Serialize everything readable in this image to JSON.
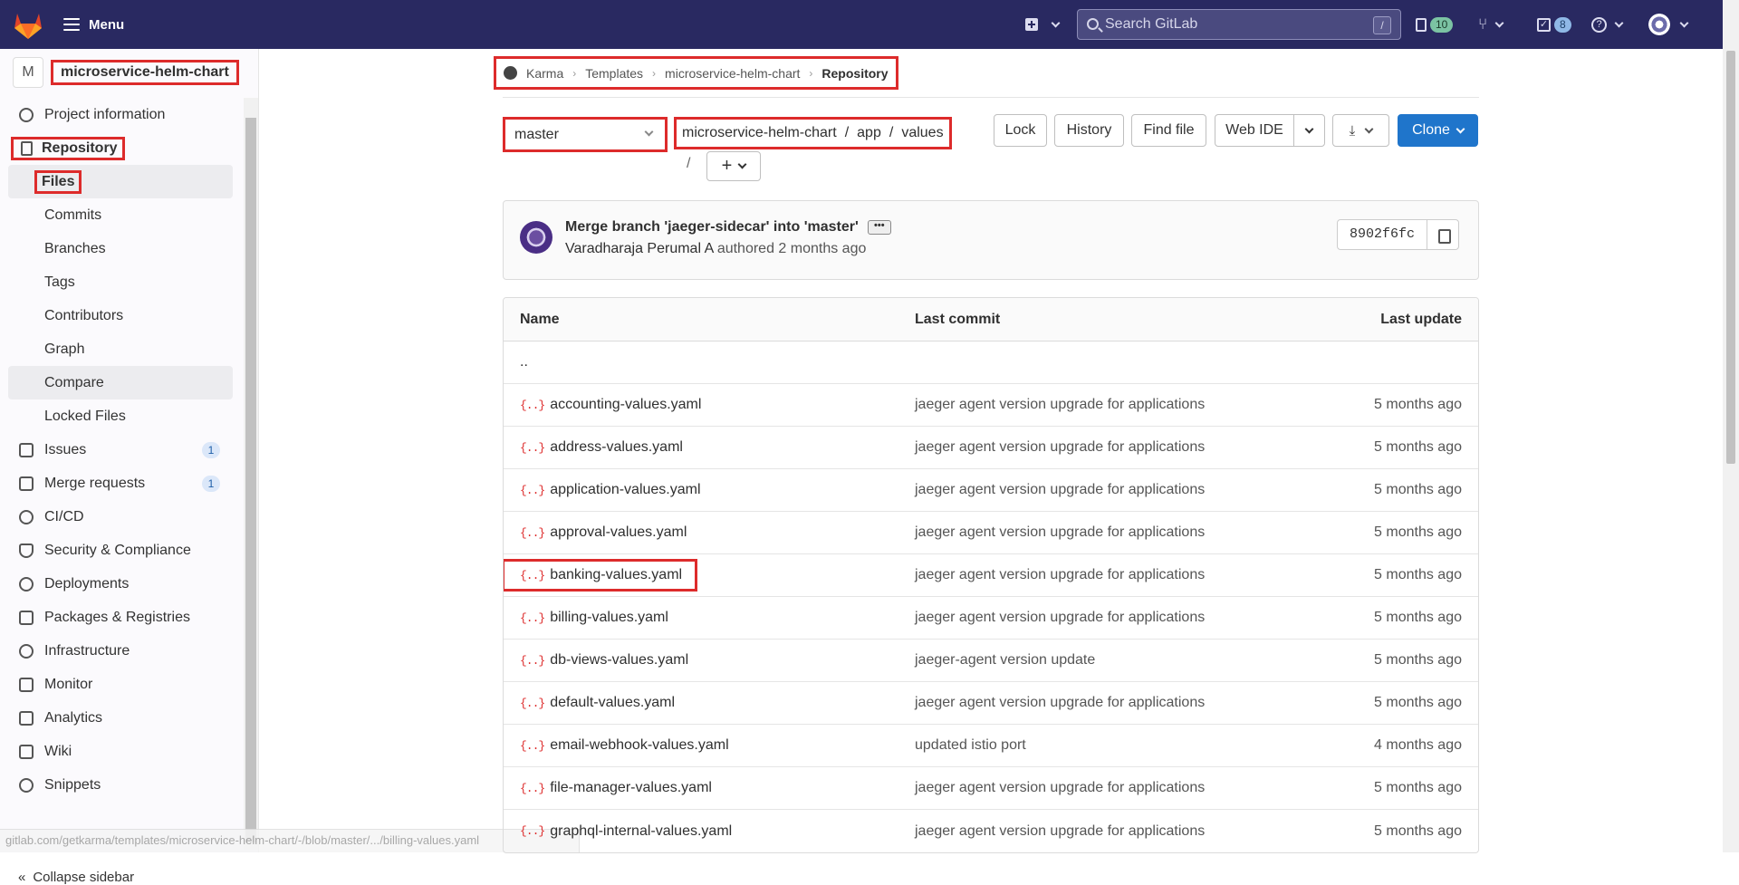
{
  "topbar": {
    "menu_label": "Menu",
    "search_placeholder": "Search GitLab",
    "search_shortcut": "/",
    "issues_count": "10",
    "todos_count": "8"
  },
  "sidebar": {
    "project_avatar": "M",
    "project_name": "microservice-helm-chart",
    "items": [
      {
        "label": "Project information"
      },
      {
        "label": "Repository"
      },
      {
        "label": "Files"
      },
      {
        "label": "Commits"
      },
      {
        "label": "Branches"
      },
      {
        "label": "Tags"
      },
      {
        "label": "Contributors"
      },
      {
        "label": "Graph"
      },
      {
        "label": "Compare"
      },
      {
        "label": "Locked Files"
      },
      {
        "label": "Issues",
        "count": "1"
      },
      {
        "label": "Merge requests",
        "count": "1"
      },
      {
        "label": "CI/CD"
      },
      {
        "label": "Security & Compliance"
      },
      {
        "label": "Deployments"
      },
      {
        "label": "Packages & Registries"
      },
      {
        "label": "Infrastructure"
      },
      {
        "label": "Monitor"
      },
      {
        "label": "Analytics"
      },
      {
        "label": "Wiki"
      },
      {
        "label": "Snippets"
      }
    ],
    "collapse_label": "Collapse sidebar"
  },
  "status_url": "gitlab.com/getkarma/templates/microservice-helm-chart/-/blob/master/.../billing-values.yaml",
  "breadcrumb": {
    "items": [
      "Karma",
      "Templates",
      "microservice-helm-chart",
      "Repository"
    ]
  },
  "repo": {
    "branch": "master",
    "path": [
      "microservice-helm-chart",
      "/",
      "app",
      "/",
      "values"
    ],
    "path_trailing_slash": "/",
    "buttons": {
      "lock": "Lock",
      "history": "History",
      "find_file": "Find file",
      "web_ide": "Web IDE",
      "clone": "Clone"
    }
  },
  "commit": {
    "message": "Merge branch 'jaeger-sidecar' into 'master'",
    "author": "Varadharaja Perumal A",
    "authored": "authored 2 months ago",
    "sha": "8902f6fc"
  },
  "files": {
    "headers": {
      "name": "Name",
      "last_commit": "Last commit",
      "last_update": "Last update"
    },
    "parent": "..",
    "rows": [
      {
        "name": "accounting-values.yaml",
        "commit": "jaeger agent version upgrade for applications",
        "updated": "5 months ago"
      },
      {
        "name": "address-values.yaml",
        "commit": "jaeger agent version upgrade for applications",
        "updated": "5 months ago"
      },
      {
        "name": "application-values.yaml",
        "commit": "jaeger agent version upgrade for applications",
        "updated": "5 months ago"
      },
      {
        "name": "approval-values.yaml",
        "commit": "jaeger agent version upgrade for applications",
        "updated": "5 months ago"
      },
      {
        "name": "banking-values.yaml",
        "commit": "jaeger agent version upgrade for applications",
        "updated": "5 months ago"
      },
      {
        "name": "billing-values.yaml",
        "commit": "jaeger agent version upgrade for applications",
        "updated": "5 months ago"
      },
      {
        "name": "db-views-values.yaml",
        "commit": "jaeger-agent version update",
        "updated": "5 months ago"
      },
      {
        "name": "default-values.yaml",
        "commit": "jaeger agent version upgrade for applications",
        "updated": "5 months ago"
      },
      {
        "name": "email-webhook-values.yaml",
        "commit": "updated istio port",
        "updated": "4 months ago"
      },
      {
        "name": "file-manager-values.yaml",
        "commit": "jaeger agent version upgrade for applications",
        "updated": "5 months ago"
      },
      {
        "name": "graphql-internal-values.yaml",
        "commit": "jaeger agent version upgrade for applications",
        "updated": "5 months ago"
      }
    ],
    "file_icon": "{..}"
  },
  "colors": {
    "topbar": "#292961",
    "highlight_box": "#dd2b2b",
    "clone_button": "#1f75cb"
  }
}
